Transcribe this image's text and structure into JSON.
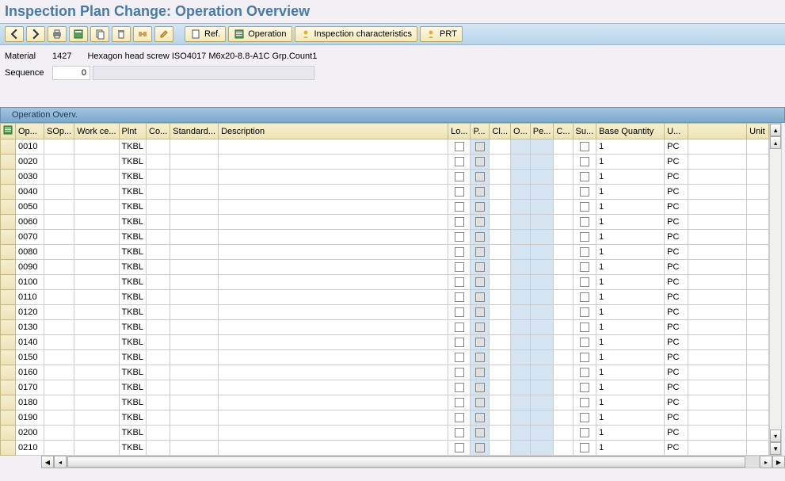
{
  "title": "Inspection Plan Change: Operation Overview",
  "toolbar": {
    "ref_label": "Ref.",
    "operation_label": "Operation",
    "insp_char_label": "Inspection characteristics",
    "prt_label": "PRT"
  },
  "info": {
    "material_label": "Material",
    "material_val": "1427",
    "material_desc": "Hexagon head screw ISO4017 M6x20-8.8-A1C Grp.Count1",
    "sequence_label": "Sequence",
    "sequence_val": "0"
  },
  "grid": {
    "title": "Operation Overv.",
    "columns": [
      "Op...",
      "SOp...",
      "Work ce...",
      "Plnt",
      "Co...",
      "Standard...",
      "Description",
      "Lo...",
      "P...",
      "Cl...",
      "O...",
      "Pe...",
      "C...",
      "Su...",
      "Base Quantity",
      "U...",
      "",
      "Unit"
    ],
    "rows": [
      {
        "op": "0010",
        "plnt": "TKBL",
        "base": "1",
        "unit": "PC"
      },
      {
        "op": "0020",
        "plnt": "TKBL",
        "base": "1",
        "unit": "PC"
      },
      {
        "op": "0030",
        "plnt": "TKBL",
        "base": "1",
        "unit": "PC"
      },
      {
        "op": "0040",
        "plnt": "TKBL",
        "base": "1",
        "unit": "PC"
      },
      {
        "op": "0050",
        "plnt": "TKBL",
        "base": "1",
        "unit": "PC"
      },
      {
        "op": "0060",
        "plnt": "TKBL",
        "base": "1",
        "unit": "PC"
      },
      {
        "op": "0070",
        "plnt": "TKBL",
        "base": "1",
        "unit": "PC"
      },
      {
        "op": "0080",
        "plnt": "TKBL",
        "base": "1",
        "unit": "PC"
      },
      {
        "op": "0090",
        "plnt": "TKBL",
        "base": "1",
        "unit": "PC"
      },
      {
        "op": "0100",
        "plnt": "TKBL",
        "base": "1",
        "unit": "PC"
      },
      {
        "op": "0110",
        "plnt": "TKBL",
        "base": "1",
        "unit": "PC"
      },
      {
        "op": "0120",
        "plnt": "TKBL",
        "base": "1",
        "unit": "PC"
      },
      {
        "op": "0130",
        "plnt": "TKBL",
        "base": "1",
        "unit": "PC"
      },
      {
        "op": "0140",
        "plnt": "TKBL",
        "base": "1",
        "unit": "PC"
      },
      {
        "op": "0150",
        "plnt": "TKBL",
        "base": "1",
        "unit": "PC"
      },
      {
        "op": "0160",
        "plnt": "TKBL",
        "base": "1",
        "unit": "PC"
      },
      {
        "op": "0170",
        "plnt": "TKBL",
        "base": "1",
        "unit": "PC"
      },
      {
        "op": "0180",
        "plnt": "TKBL",
        "base": "1",
        "unit": "PC"
      },
      {
        "op": "0190",
        "plnt": "TKBL",
        "base": "1",
        "unit": "PC"
      },
      {
        "op": "0200",
        "plnt": "TKBL",
        "base": "1",
        "unit": "PC"
      },
      {
        "op": "0210",
        "plnt": "TKBL",
        "base": "1",
        "unit": "PC"
      }
    ]
  }
}
